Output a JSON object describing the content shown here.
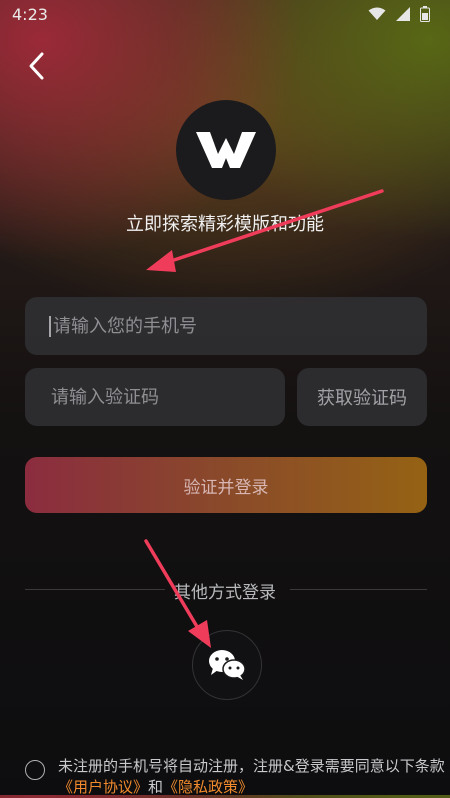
{
  "status": {
    "time": "4:23"
  },
  "icons": {
    "back": "chevron-left-icon",
    "wifi": "wifi-icon",
    "signal": "signal-icon",
    "battery": "battery-icon",
    "logo": "w-logo-icon",
    "wechat": "wechat-icon"
  },
  "header": {
    "tagline": "立即探索精彩模版和功能"
  },
  "form": {
    "phone_placeholder": "请输入您的手机号",
    "code_placeholder": "请输入验证码",
    "get_code_label": "获取验证码",
    "submit_label": "验证并登录"
  },
  "other_login": {
    "label": "其他方式登录"
  },
  "agreement": {
    "text_prefix": "未注册的手机号将自动注册，注册&登录需要同意以下条款",
    "user_agreement": "《用户协议》",
    "and": "和",
    "privacy_policy": "《隐私政策》"
  },
  "colors": {
    "accent_link": "#f08a2d",
    "button_start": "#8b2c3f",
    "button_end": "#956214",
    "annotation_arrow": "#ef3c5a"
  }
}
